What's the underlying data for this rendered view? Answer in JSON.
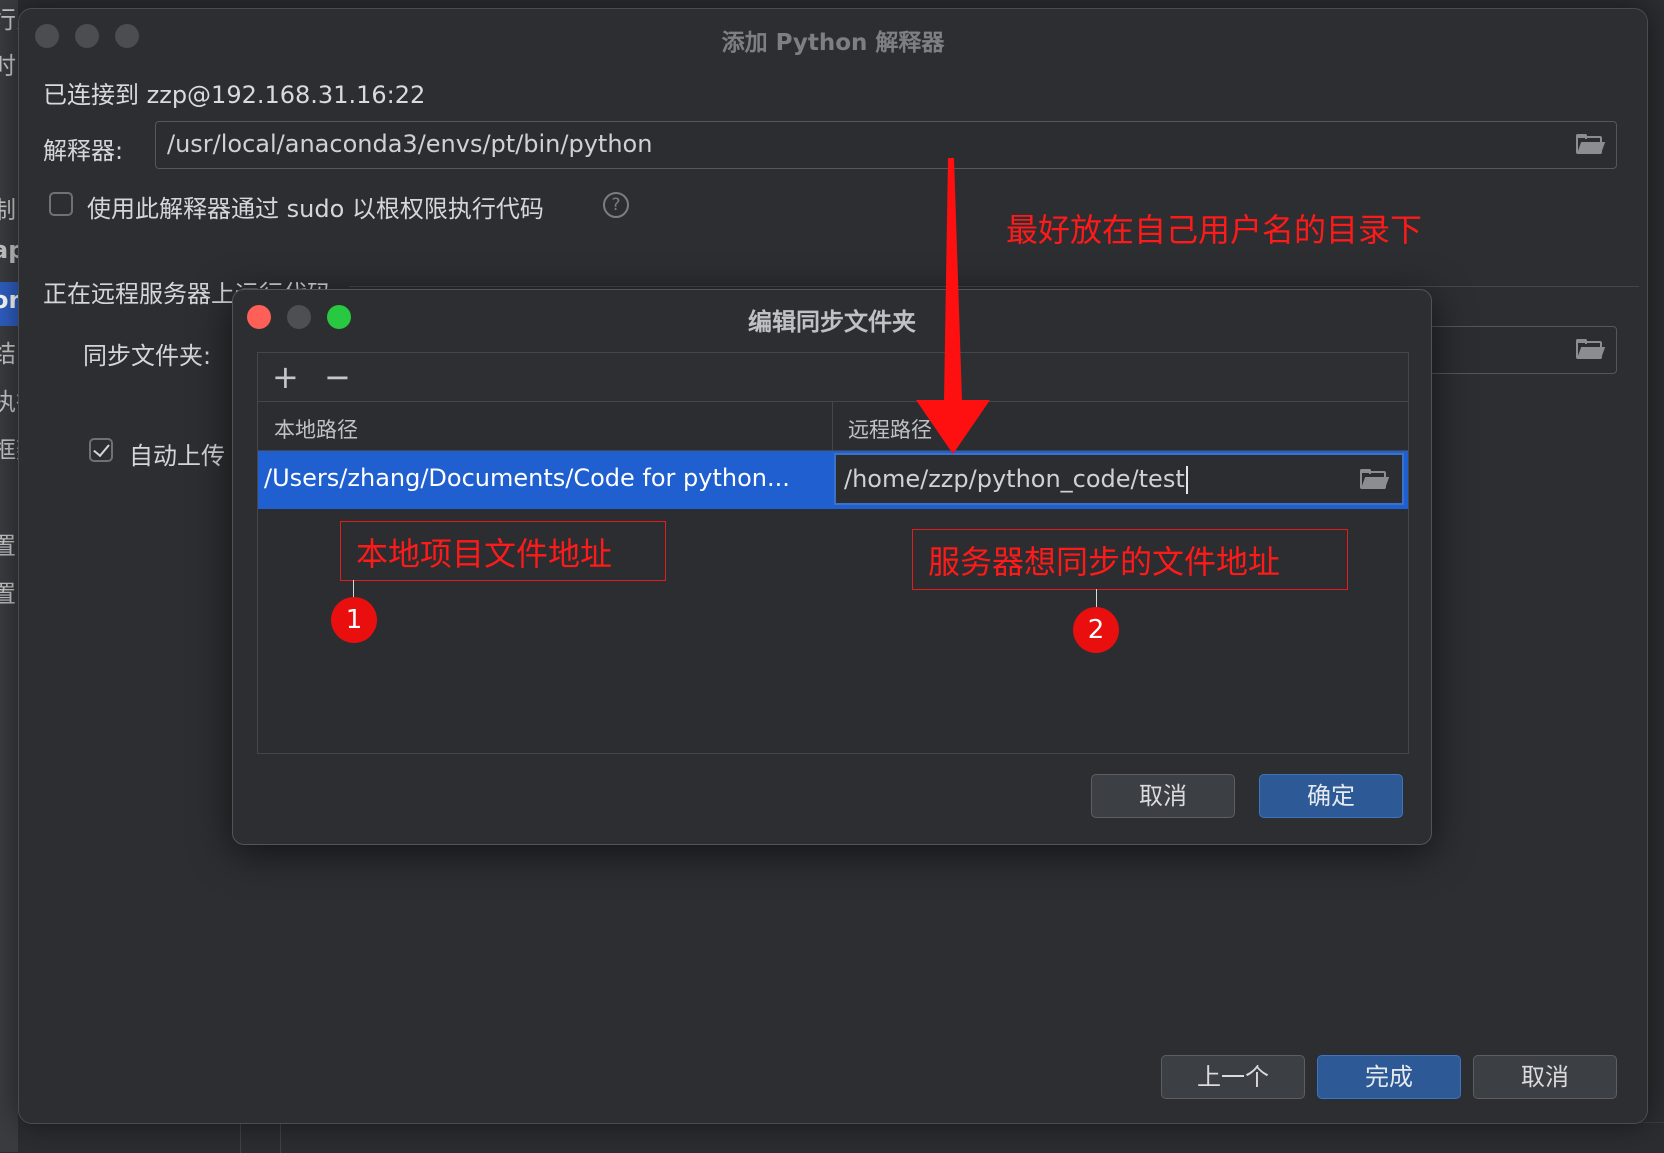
{
  "background": {
    "side_glyphs": [
      "行为",
      "时",
      "制",
      "ap",
      "on",
      "结",
      "执行",
      "框架",
      "置",
      "置"
    ]
  },
  "main_dialog": {
    "title": "添加 Python 解释器",
    "connected": "已连接到 zzp@192.168.31.16:22",
    "interpreter_label": "解释器:",
    "interpreter_value": "/usr/local/anaconda3/envs/pt/bin/python",
    "sudo_label": "使用此解释器通过 sudo 以根权限执行代码",
    "sudo_checked": false,
    "remote_section": "正在远程服务器上运行代码",
    "sync_label": "同步文件夹:",
    "auto_upload_label": "自动上传",
    "auto_upload_checked": true,
    "buttons": {
      "prev": "上一个",
      "finish": "完成",
      "cancel": "取消"
    }
  },
  "sync_dialog": {
    "title": "编辑同步文件夹",
    "toolbar": {
      "add": "+",
      "remove": "−"
    },
    "columns": [
      "本地路径",
      "远程路径"
    ],
    "rows": [
      {
        "local": "/Users/zhang/Documents/Code for python...",
        "remote": "/home/zzp/python_code/test"
      }
    ],
    "buttons": {
      "cancel": "取消",
      "ok": "确定"
    }
  },
  "annotations": {
    "top_note": "最好放在自己用户名的目录下",
    "local_note": "本地项目文件地址",
    "remote_note": "服务器想同步的文件地址",
    "badge1": "1",
    "badge2": "2",
    "accent_color": "#ff1a1a"
  },
  "colors": {
    "selection_blue": "#1f5fd0",
    "primary_button": "#2d5a97",
    "dialog_bg": "#2c2e31"
  }
}
